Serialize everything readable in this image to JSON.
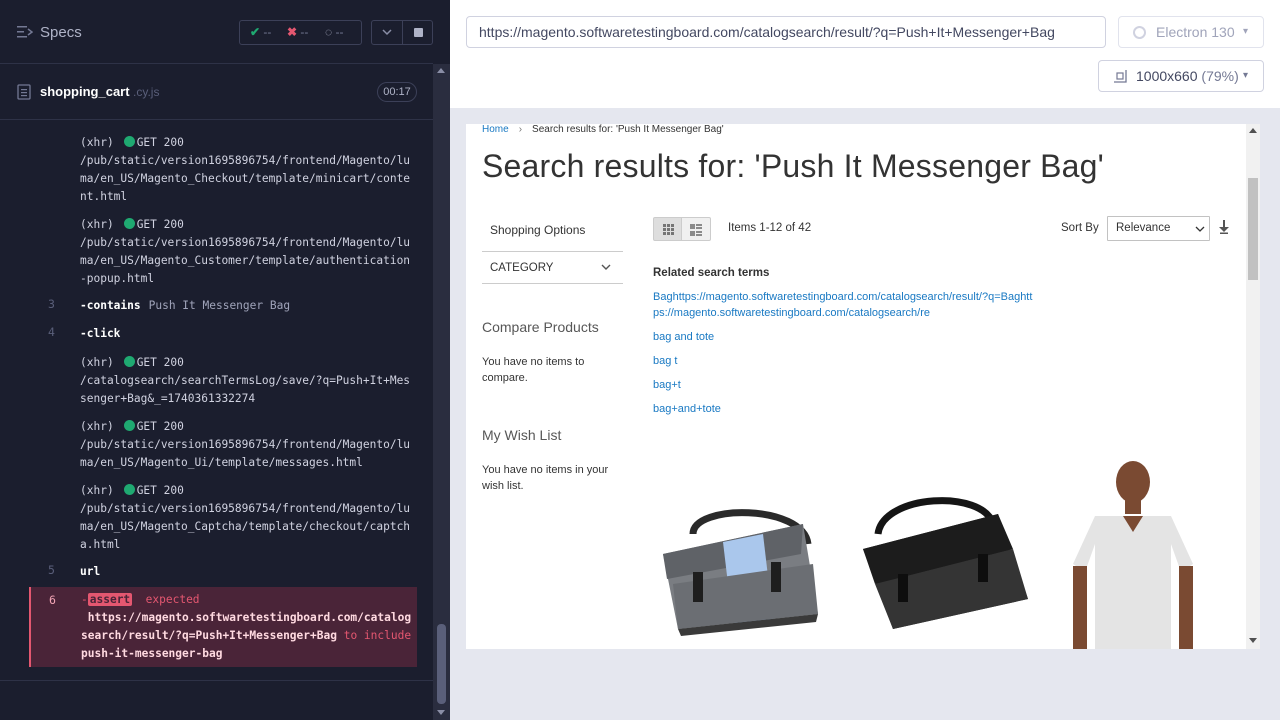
{
  "reporter": {
    "title": "Specs",
    "stats": {
      "passed": "--",
      "failed": "--",
      "pending": "--"
    },
    "spec": {
      "name": "shopping_cart",
      "ext": ".cy.js",
      "timer": "00:17"
    },
    "log": [
      {
        "kind": "xhr",
        "tag": "(xhr)",
        "method": "GET 200",
        "url": "/pub/static/version1695896754/frontend/Magento/luma/en_US/Magento_Checkout/template/minicart/content.html"
      },
      {
        "kind": "xhr",
        "tag": "(xhr)",
        "method": "GET 200",
        "url": "/pub/static/version1695896754/frontend/Magento/luma/en_US/Magento_Customer/template/authentication-popup.html"
      },
      {
        "kind": "cmd",
        "num": "3",
        "name": "-contains",
        "arg": "Push It Messenger Bag"
      },
      {
        "kind": "cmd",
        "num": "4",
        "name": "-click",
        "arg": ""
      },
      {
        "kind": "xhr",
        "tag": "(xhr)",
        "method": "GET 200",
        "url": "/catalogsearch/searchTermsLog/save/?q=Push+It+Messenger+Bag&_=1740361332274"
      },
      {
        "kind": "xhr",
        "tag": "(xhr)",
        "method": "GET 200",
        "url": "/pub/static/version1695896754/frontend/Magento/luma/en_US/Magento_Ui/template/messages.html"
      },
      {
        "kind": "xhr",
        "tag": "(xhr)",
        "method": "GET 200",
        "url": "/pub/static/version1695896754/frontend/Magento/luma/en_US/Magento_Captcha/template/checkout/captcha.html"
      },
      {
        "kind": "cmd",
        "num": "5",
        "name": "url",
        "arg": ""
      }
    ],
    "assert": {
      "num": "6",
      "badge": "assert",
      "expected": "expected",
      "value": "https://magento.softwaretestingboard.com/catalogsearch/result/?q=Push+It+Messenger+Bag",
      "to_include": "to include",
      "include": "push-it-messenger-bag"
    }
  },
  "aut": {
    "url": "https://magento.softwaretestingboard.com/catalogsearch/result/?q=Push+It+Messenger+Bag",
    "browser": "Electron 130",
    "viewport": "1000x660",
    "scale": "(79%)"
  },
  "page": {
    "breadcrumb": {
      "home": "Home",
      "current": "Search results for: 'Push It Messenger Bag'"
    },
    "title": "Search results for: 'Push It Messenger Bag'",
    "sidebar": {
      "shopping_options": "Shopping Options",
      "category": "CATEGORY",
      "compare_title": "Compare Products",
      "compare_text": "You have no items to compare.",
      "wish_title": "My Wish List",
      "wish_text": "You have no items in your wish list."
    },
    "toolbar": {
      "items": "Items 1-12 of 42",
      "sort_label": "Sort By",
      "sort_value": "Relevance"
    },
    "related": {
      "title": "Related search terms",
      "terms": [
        "Baghttps://magento.softwaretestingboard.com/catalogsearch/result/?q=Baghttps://magento.softwaretestingboard.com/catalogsearch/re",
        "bag and tote",
        "bag t",
        "bag+t",
        "bag+and+tote"
      ]
    }
  },
  "colors": {
    "pass": "#1fa971",
    "fail": "#e45770",
    "link": "#1979c3",
    "reporter_bg": "#1b1e2e"
  }
}
